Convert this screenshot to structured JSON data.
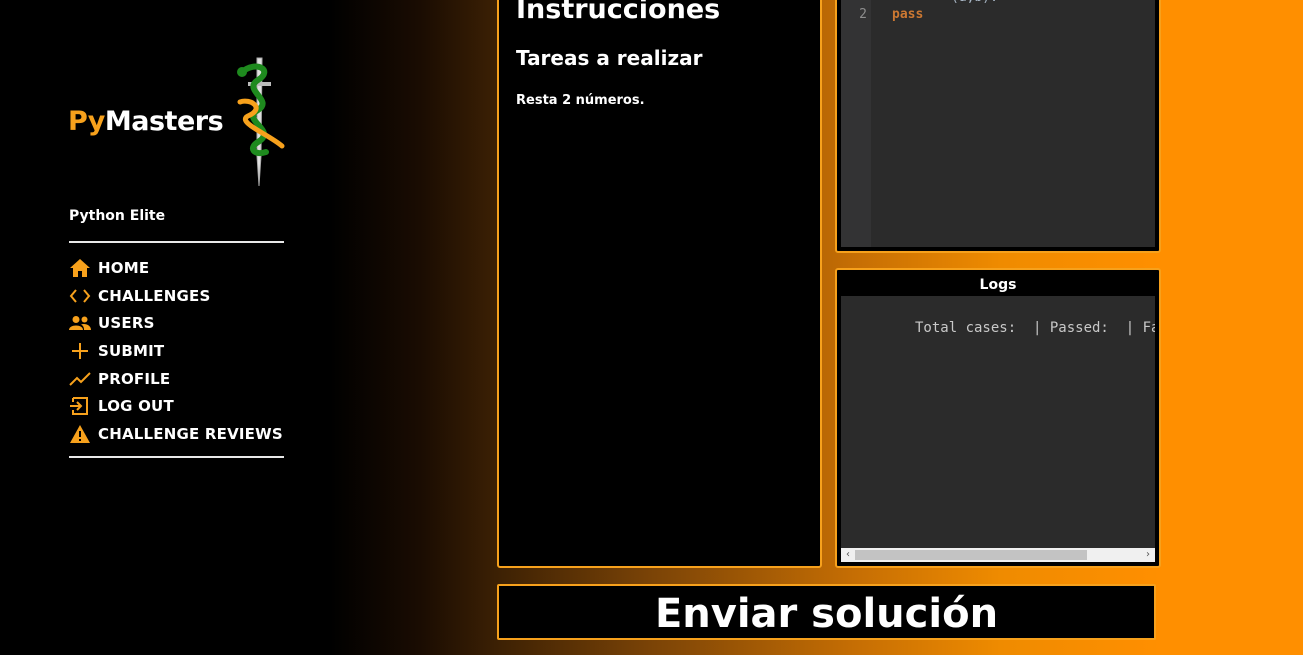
{
  "brand": {
    "logo_py": "Py",
    "logo_masters": "Masters"
  },
  "sidebar": {
    "user_level": "Python Elite",
    "items": [
      {
        "label": "HOME",
        "icon": "home-icon"
      },
      {
        "label": "CHALLENGES",
        "icon": "code-icon"
      },
      {
        "label": "USERS",
        "icon": "users-icon"
      },
      {
        "label": "SUBMIT",
        "icon": "plus-icon"
      },
      {
        "label": "PROFILE",
        "icon": "trending-icon"
      },
      {
        "label": "LOG OUT",
        "icon": "logout-icon"
      },
      {
        "label": "CHALLENGE REVIEWS",
        "icon": "warning-icon"
      }
    ]
  },
  "instructions": {
    "title": "Instrucciones",
    "subtitle": "Tareas a realizar",
    "text": "Resta 2 números."
  },
  "editor": {
    "lines": [
      {
        "number": "2",
        "code": "pass"
      }
    ]
  },
  "logs": {
    "title": "Logs",
    "output": "Total cases:  | Passed:  | Failed:"
  },
  "submit": {
    "label": "Enviar solución"
  },
  "colors": {
    "accent": "#f7a11c",
    "keyword": "#cc7832",
    "panel": "#2b2b2b"
  }
}
